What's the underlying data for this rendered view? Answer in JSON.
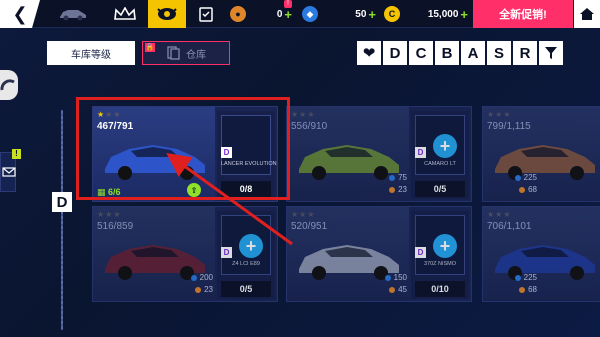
{
  "topbar": {
    "back_icon": "chevron-left-icon",
    "tabs": [
      {
        "name": "car-tab",
        "icon": "car-icon"
      },
      {
        "name": "crown-tab",
        "icon": "crown-icon"
      },
      {
        "name": "garage-tab",
        "icon": "eye-badge-icon",
        "active": true
      },
      {
        "name": "checklist-tab",
        "icon": "checklist-icon"
      }
    ],
    "currencies": [
      {
        "icon": "token-icon",
        "value": "0",
        "color": "#e0862a"
      },
      {
        "icon": "gem-icon",
        "value": "50",
        "color": "#2a7ae0"
      },
      {
        "icon": "credits-icon",
        "value": "15,000",
        "color": "#f5c400"
      }
    ],
    "badge_text": "!",
    "promo_label": "全新促销!",
    "home_icon": "home-icon"
  },
  "filters": {
    "garage_level_label": "车库等级",
    "storage_label": "仓库",
    "class_letters": [
      "D",
      "C",
      "B",
      "A",
      "S",
      "R"
    ],
    "heart_icon": "heart-icon",
    "filter_icon": "funnel-icon"
  },
  "section": {
    "class_label": "D",
    "notice_badge": "!"
  },
  "cards": [
    {
      "progress": "467/791",
      "stars": 1,
      "blueprint_class": "D",
      "blueprint_name": "LANCER EVOLUTION",
      "blueprint_count": "0/8",
      "fuel": "6/6",
      "unlocked": true,
      "car_color": "#2d54c8"
    },
    {
      "progress": "556/910",
      "stars": 0,
      "blueprint_class": "D",
      "blueprint_name": "CAMARO LT",
      "blueprint_count": "0/5",
      "stat_blue": "75",
      "stat_orange": "23",
      "unlocked": false,
      "car_color": "#9fd11f"
    },
    {
      "progress": "799/1,115",
      "stars": 0,
      "blueprint_class": "D",
      "blueprint_name": "",
      "blueprint_count": "",
      "stat_blue": "225",
      "stat_orange": "68",
      "unlocked": false,
      "car_color": "#c8722a"
    },
    {
      "progress": "516/859",
      "stars": 0,
      "blueprint_class": "D",
      "blueprint_name": "Z4 LCI E89",
      "blueprint_count": "0/5",
      "stat_blue": "200",
      "stat_orange": "23",
      "unlocked": false,
      "car_color": "#9b1b1b"
    },
    {
      "progress": "520/951",
      "stars": 0,
      "blueprint_class": "D",
      "blueprint_name": "370Z NISMO",
      "blueprint_count": "0/10",
      "stat_blue": "150",
      "stat_orange": "45",
      "unlocked": false,
      "car_color": "#e8ecf5"
    },
    {
      "progress": "706/1,101",
      "stars": 0,
      "blueprint_class": "D",
      "blueprint_name": "",
      "blueprint_count": "",
      "stat_blue": "225",
      "stat_orange": "68",
      "unlocked": false,
      "car_color": "#2045c8"
    }
  ]
}
